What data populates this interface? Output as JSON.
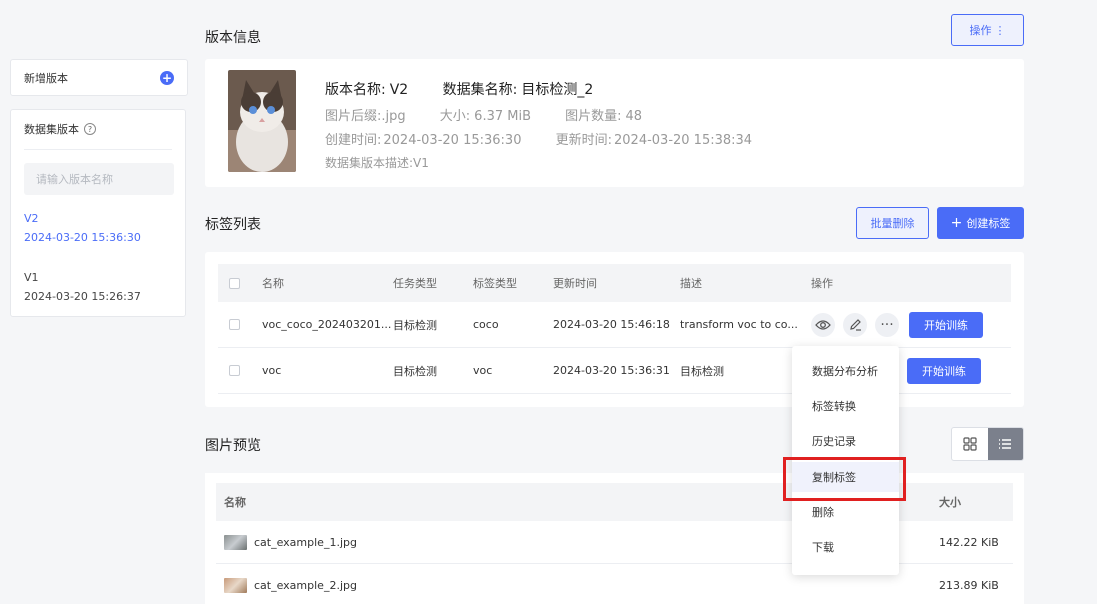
{
  "sidebar": {
    "new_version_label": "新增版本",
    "panel_title": "数据集版本",
    "search_placeholder": "请输入版本名称",
    "versions": [
      {
        "name": "V2",
        "time": "2024-03-20 15:36:30",
        "active": true
      },
      {
        "name": "V1",
        "time": "2024-03-20 15:26:37",
        "active": false
      }
    ]
  },
  "version_info": {
    "section_title": "版本信息",
    "operate_button": "操作",
    "name_label": "版本名称:",
    "name_value": "V2",
    "dataset_label": "数据集名称:",
    "dataset_value": "目标检测_2",
    "suffix_label": "图片后缀:",
    "suffix_value": ".jpg",
    "size_label": "大小:",
    "size_value": "6.37 MiB",
    "count_label": "图片数量:",
    "count_value": "48",
    "created_label": "创建时间:",
    "created_value": "2024-03-20 15:36:30",
    "updated_label": "更新时间:",
    "updated_value": "2024-03-20 15:38:34",
    "desc_label": "数据集版本描述:",
    "desc_value": "V1"
  },
  "labels": {
    "section_title": "标签列表",
    "batch_delete": "批量删除",
    "create_label": "创建标签",
    "columns": {
      "name": "名称",
      "task_type": "任务类型",
      "label_type": "标签类型",
      "updated": "更新时间",
      "desc": "描述",
      "ops": "操作"
    },
    "rows": [
      {
        "name": "voc_coco_202403201...",
        "task_type": "目标检测",
        "label_type": "coco",
        "updated": "2024-03-20 15:46:18",
        "desc": "transform voc to co...",
        "train": "开始训练"
      },
      {
        "name": "voc",
        "task_type": "目标检测",
        "label_type": "voc",
        "updated": "2024-03-20 15:36:31",
        "desc": "目标检测",
        "train": "开始训练"
      }
    ]
  },
  "menu": {
    "items": [
      "数据分布分析",
      "标签转换",
      "历史记录",
      "复制标签",
      "删除",
      "下载"
    ]
  },
  "preview": {
    "section_title": "图片预览",
    "col_name": "名称",
    "col_size": "大小",
    "rows": [
      {
        "name": "cat_example_1.jpg",
        "size": "142.22 KiB"
      },
      {
        "name": "cat_example_2.jpg",
        "size": "213.89 KiB"
      }
    ]
  },
  "colors": {
    "accent": "#4a6cf7",
    "highlight": "#e02020"
  }
}
